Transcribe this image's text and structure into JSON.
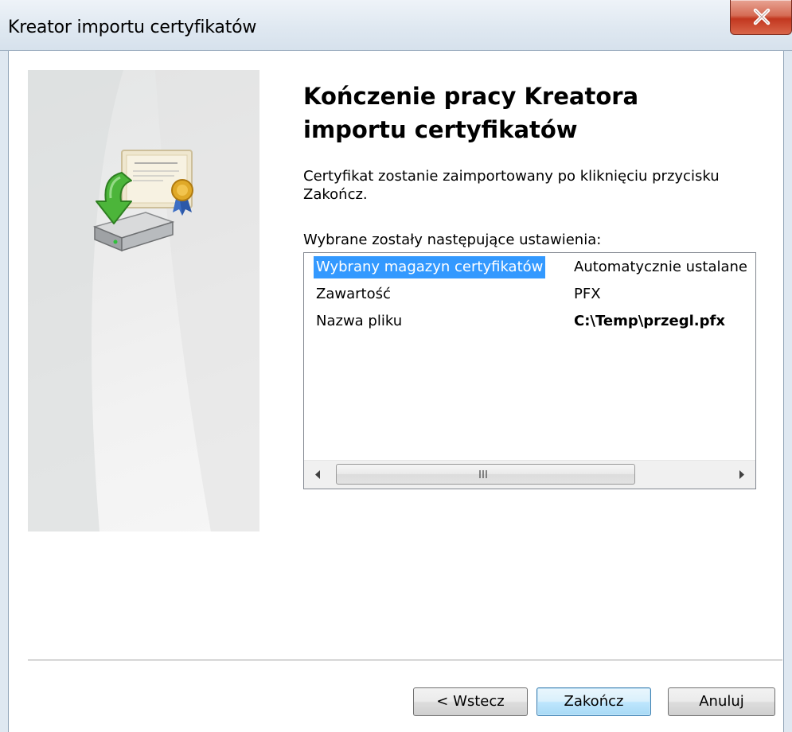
{
  "window": {
    "title": "Kreator importu certyfikatów"
  },
  "main": {
    "heading": "Kończenie pracy Kreatora importu certyfikatów",
    "description": "Certyfikat zostanie zaimportowany po kliknięciu przycisku Zakończ.",
    "settings_label": "Wybrane zostały następujące ustawienia:"
  },
  "settings_list": {
    "rows": [
      {
        "key": "Wybrany magazyn certyfikatów",
        "value": "Automatycznie ustalane"
      },
      {
        "key": "Zawartość",
        "value": "PFX"
      },
      {
        "key": "Nazwa pliku",
        "value": "C:\\Temp\\przegl.pfx"
      }
    ],
    "selected_row": 0
  },
  "buttons": {
    "back_label": "< Wstecz",
    "finish_label": "Zakończ",
    "cancel_label": "Anuluj"
  },
  "icons": {
    "close": "close-icon",
    "wizard_graphic": "certificate-import-icon"
  },
  "colors": {
    "selection": "#3399ff",
    "close_button": "#c2371f"
  }
}
